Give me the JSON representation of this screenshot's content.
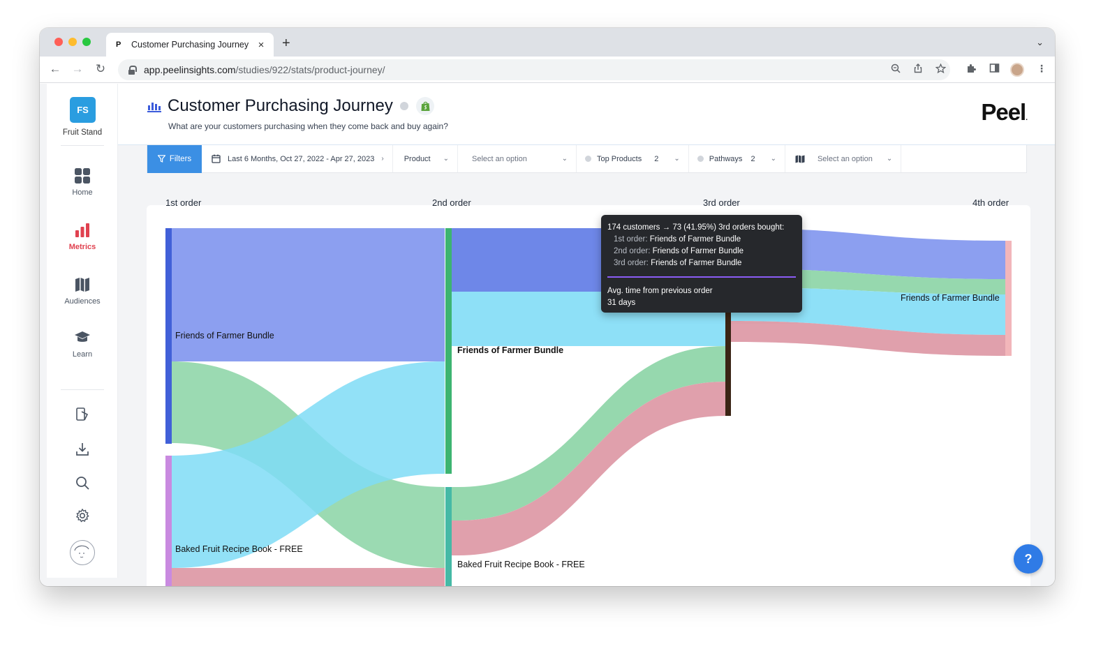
{
  "browser": {
    "tab_title": "Customer Purchasing Journey",
    "tab_favicon": "P",
    "tab_close": "×",
    "new_tab": "+",
    "tab_menu": "⌄",
    "url_domain": "app.peelinsights.com",
    "url_path": "/studies/922/stats/product-journey/"
  },
  "sidebar": {
    "org_initials": "FS",
    "org_name": "Fruit Stand",
    "items": [
      {
        "label": "Home",
        "icon": "home-grid-icon"
      },
      {
        "label": "Metrics",
        "icon": "bar-chart-icon",
        "active": true
      },
      {
        "label": "Audiences",
        "icon": "map-icon"
      },
      {
        "label": "Learn",
        "icon": "graduation-cap-icon"
      }
    ],
    "utility_icons": [
      "notebook-icon",
      "download-icon",
      "search-icon",
      "settings-gear-icon",
      "user-avatar"
    ]
  },
  "header": {
    "title": "Customer Purchasing Journey",
    "subtitle": "What are your customers purchasing when they come back and buy again?",
    "brand": "Peel",
    "brand_dot": "."
  },
  "filters": {
    "filters_label": "Filters",
    "date_range": "Last 6 Months, Oct 27, 2022 - Apr 27, 2023",
    "product_label": "Product",
    "product_select_placeholder": "Select an option",
    "top_products_label": "Top Products",
    "top_products_value": "2",
    "pathways_label": "Pathways",
    "pathways_value": "2",
    "view_select_placeholder": "Select an option"
  },
  "chart": {
    "columns": [
      "1st order",
      "2nd order",
      "3rd order",
      "4th order"
    ],
    "node_labels": {
      "o1_friends": "Friends of Farmer Bundle",
      "o1_baked": "Baked Fruit Recipe Book - FREE",
      "o2_friends": "Friends of Farmer Bundle",
      "o2_baked": "Baked Fruit Recipe Book - FREE",
      "o4_friends": "Friends of Farmer Bundle"
    },
    "colors": {
      "blue": "#8c9ff0",
      "blue_dark": "#6e87e8",
      "cyan": "#8ee0f7",
      "green": "#96d8ae",
      "pink": "#e0a0ac",
      "node_blue": "#4160d8",
      "node_green": "#3db471",
      "node_violet": "#c98ae0",
      "node_teal": "#45b9a6",
      "node_dark": "#3a2414",
      "node_pink": "#f2b6ba"
    }
  },
  "tooltip": {
    "headline": "174 customers → 73 (41.95%) 3rd orders bought:",
    "order1_key": "1st order:",
    "order1_val": "Friends of Farmer Bundle",
    "order2_key": "2nd order:",
    "order2_val": "Friends of Farmer Bundle",
    "order3_key": "3rd order:",
    "order3_val": "Friends of Farmer Bundle",
    "avg_label": "Avg. time from previous order",
    "avg_value": "31 days"
  },
  "help": {
    "label": "?"
  }
}
